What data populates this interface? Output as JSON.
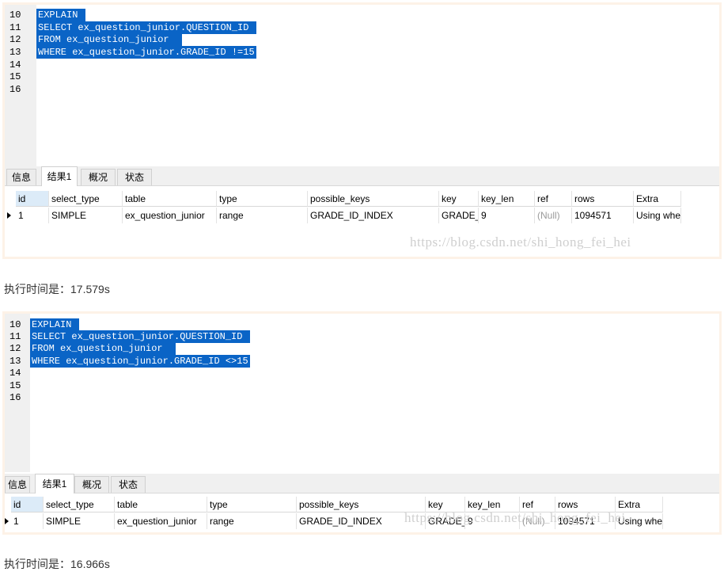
{
  "query1": {
    "editor_lines": [
      {
        "num": "10",
        "code": "EXPLAIN "
      },
      {
        "num": "11",
        "code": "SELECT ex_question_junior.QUESTION_ID "
      },
      {
        "num": "12",
        "code": "FROM ex_question_junior  "
      },
      {
        "num": "13",
        "code": "WHERE ex_question_junior.GRADE_ID !=15"
      },
      {
        "num": "14",
        "code": ""
      },
      {
        "num": "15",
        "code": ""
      },
      {
        "num": "16",
        "code": ""
      }
    ],
    "tabs": [
      "信息",
      "结果1",
      "概况",
      "状态"
    ],
    "columns": [
      "id",
      "select_type",
      "table",
      "type",
      "possible_keys",
      "key",
      "key_len",
      "ref",
      "rows",
      "Extra"
    ],
    "row": [
      "1",
      "SIMPLE",
      "ex_question_junior",
      "range",
      "GRADE_ID_INDEX",
      "GRADE_",
      "9",
      "(Null)",
      "1094571",
      "Using whe"
    ],
    "watermark": "https://blog.csdn.net/shi_hong_fei_hei",
    "execution_time": "执行时间是：17.579s"
  },
  "query2": {
    "editor_lines": [
      {
        "num": "10",
        "code": "EXPLAIN "
      },
      {
        "num": "11",
        "code": "SELECT ex_question_junior.QUESTION_ID "
      },
      {
        "num": "12",
        "code": "FROM ex_question_junior  "
      },
      {
        "num": "13",
        "code": "WHERE ex_question_junior.GRADE_ID <>15"
      },
      {
        "num": "14",
        "code": ""
      },
      {
        "num": "15",
        "code": ""
      },
      {
        "num": "16",
        "code": ""
      }
    ],
    "tabs": [
      "信息",
      "结果1",
      "概况",
      "状态"
    ],
    "columns": [
      "id",
      "select_type",
      "table",
      "type",
      "possible_keys",
      "key",
      "key_len",
      "ref",
      "rows",
      "Extra"
    ],
    "row": [
      "1",
      "SIMPLE",
      "ex_question_junior",
      "range",
      "GRADE_ID_INDEX",
      "GRADE_",
      "9",
      "(Null)",
      "1094571",
      "Using whe"
    ],
    "watermark": "https://blog.csdn.net/shi_hong_fei_hei",
    "execution_time": "执行时间是：16.966s"
  },
  "colors": {
    "selection": "#0a64c6",
    "gutter": "#f0f0f0",
    "panel_border": "#fdf2e7",
    "header_highlight": "#dcebf8"
  }
}
